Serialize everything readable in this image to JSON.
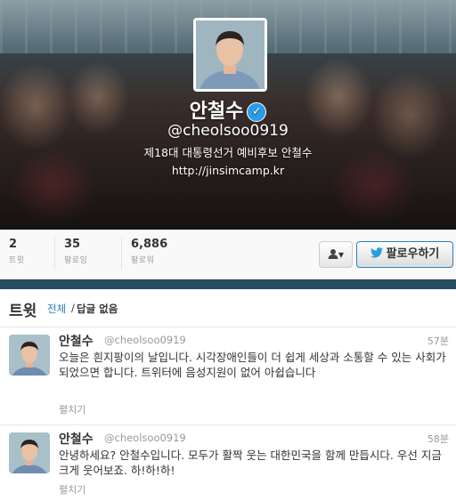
{
  "profile": {
    "name": "안철수",
    "handle": "@cheolsoo0919",
    "bio": "제18대 대통령선거 예비후보 안철수",
    "url": "http://jinsimcamp.kr"
  },
  "stats": [
    {
      "value": "2",
      "label": "트윗"
    },
    {
      "value": "35",
      "label": "팔로잉"
    },
    {
      "value": "6,886",
      "label": "팔로워"
    }
  ],
  "actions": {
    "follow_label": "팔로우하기",
    "user_menu_label": "▾"
  },
  "tweets_section": {
    "title": "트윗",
    "filter_all": "전체",
    "filter_sep": "/",
    "filter_no_replies": "답글 없음"
  },
  "tweets": [
    {
      "name": "안철수",
      "handle": "@cheolsoo0919",
      "time": "57분",
      "text": "오늘은 흰지팡이의 날입니다. 시각장애인들이 더 쉽게 세상과 소통할 수 있는 사회가 되었으면 합니다. 트위터에 음성지원이 없어 아쉽습니다",
      "expand": "펼치기"
    },
    {
      "name": "안철수",
      "handle": "@cheolsoo0919",
      "time": "58분",
      "text": "안녕하세요? 안철수입니다. 모두가 활짝 웃는 대한민국을 함께 만듭시다. 우선 지금 크게 웃어보죠. 하!하!하!",
      "expand": "펼치기"
    }
  ],
  "colors": {
    "link": "#2a7cb8",
    "verified": "#2b9be3",
    "divider_band": "#2a4c63"
  }
}
